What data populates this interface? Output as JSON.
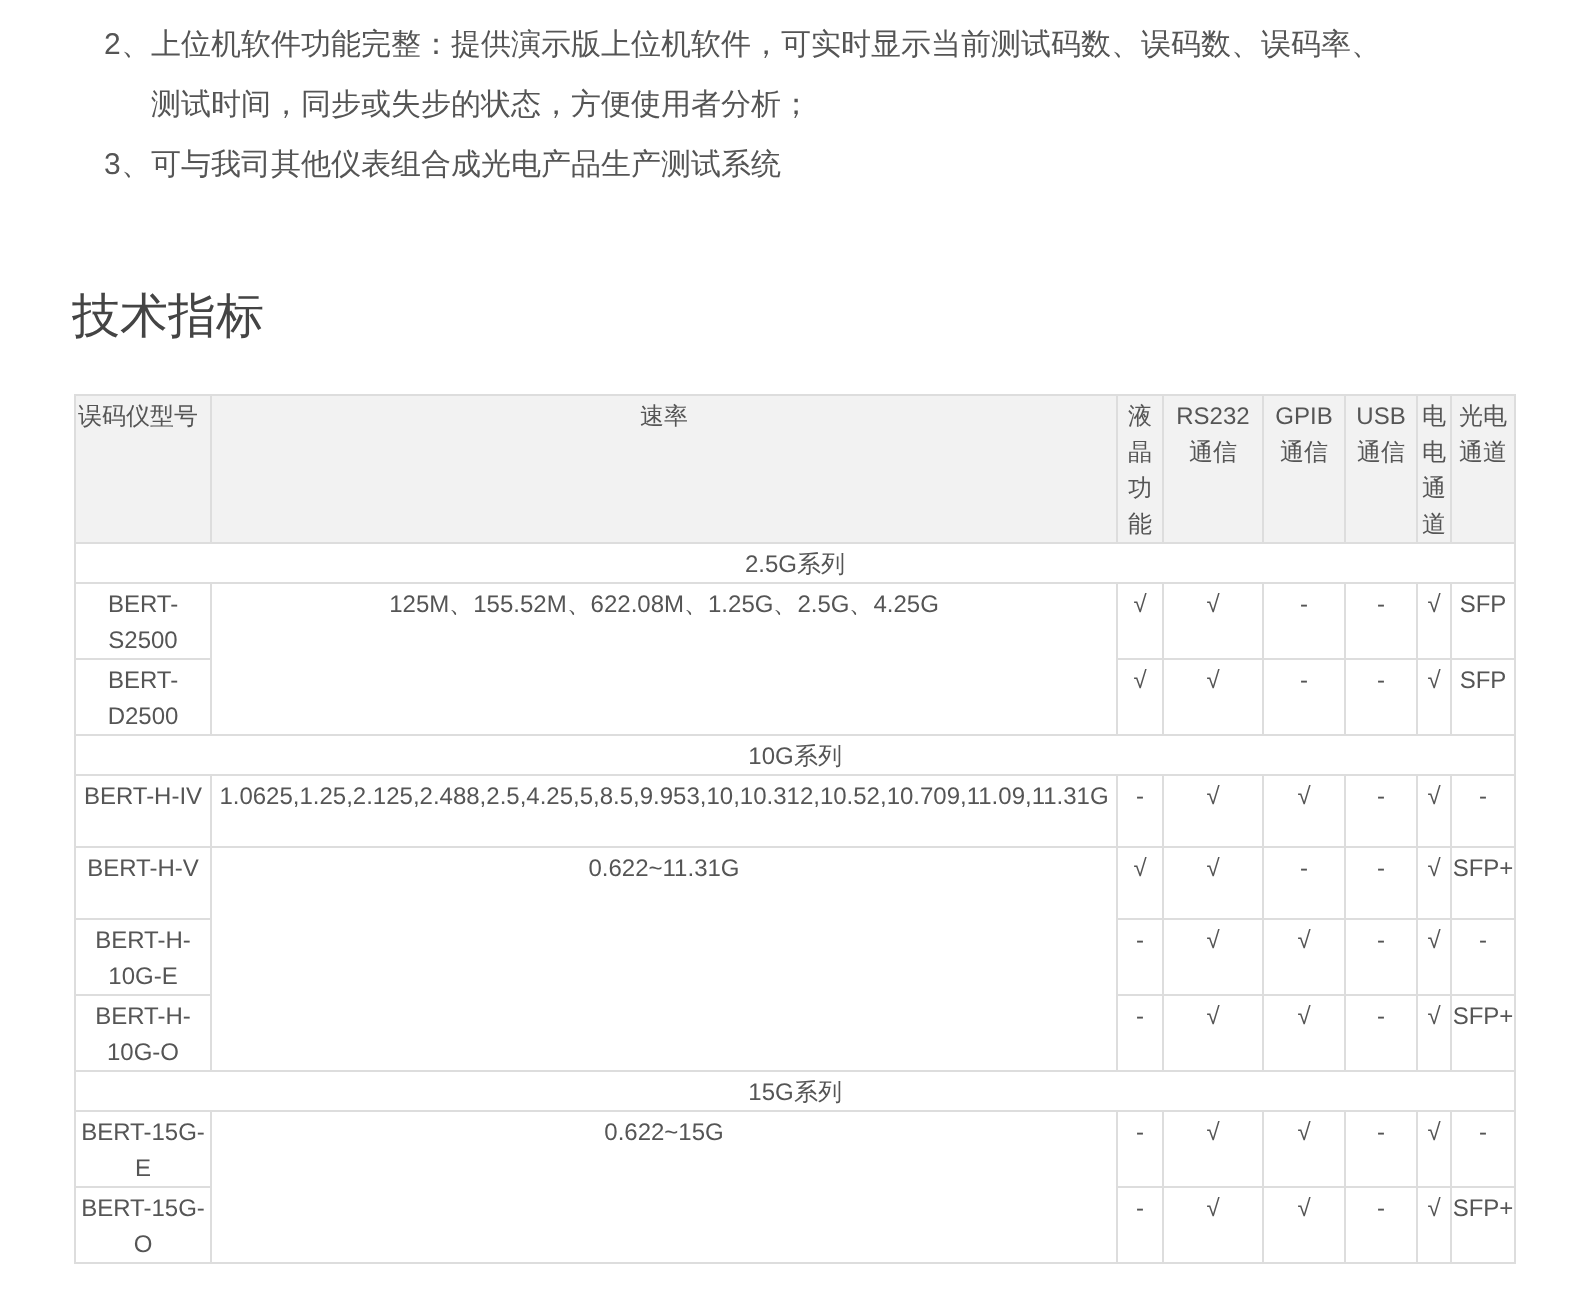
{
  "intro_list": [
    {
      "marker": "2、",
      "text": "上位机软件功能完整：提供演示版上位机软件，可实时显示当前测试码数、误码数、误码率、测试时间，同步或失步的状态，方便使用者分析；"
    },
    {
      "marker": "3、",
      "text": "可与我司其他仪表组合成光电产品生产测试系统"
    }
  ],
  "section_title": "技术指标",
  "table": {
    "columns": [
      "误码仪型号",
      "速率",
      "液晶功能",
      "RS232通信",
      "GPIB通信",
      "USB通信",
      "电电通道",
      "光电通道"
    ],
    "groups": [
      {
        "title": "2.5G系列",
        "speed": "125M、155.52M、622.08M、1.25G、2.5G、4.25G",
        "rows": [
          {
            "model": "BERT-S2500",
            "cells": [
              "√",
              "√",
              "-",
              "-",
              "√",
              "SFP"
            ]
          },
          {
            "model": "BERT-D2500",
            "cells": [
              "√",
              "√",
              "-",
              "-",
              "√",
              "SFP"
            ]
          }
        ]
      },
      {
        "title": "10G系列",
        "speed": "1.0625,1.25,2.125,2.488,2.5,4.25,5,8.5,9.953,10,10.312,10.52,10.709,11.09,11.31G",
        "rows": [
          {
            "model": "BERT-H-IV",
            "cells": [
              "-",
              "√",
              "√",
              "-",
              "√",
              "-"
            ]
          }
        ]
      },
      {
        "speed": "0.622~11.31G",
        "rows": [
          {
            "model": "BERT-H-V",
            "cells": [
              "√",
              "√",
              "-",
              "-",
              "√",
              "SFP+"
            ]
          },
          {
            "model": "BERT-H-10G-E",
            "cells": [
              "-",
              "√",
              "√",
              "-",
              "√",
              "-"
            ]
          },
          {
            "model": "BERT-H-10G-O",
            "cells": [
              "-",
              "√",
              "√",
              "-",
              "√",
              "SFP+"
            ]
          }
        ]
      },
      {
        "title": "15G系列",
        "speed": "0.622~15G",
        "rows": [
          {
            "model": "BERT-15G-E",
            "cells": [
              "-",
              "√",
              "√",
              "-",
              "√",
              "-"
            ]
          },
          {
            "model": "BERT-15G-O",
            "cells": [
              "-",
              "√",
              "√",
              "-",
              "√",
              "SFP+"
            ]
          }
        ]
      }
    ]
  }
}
